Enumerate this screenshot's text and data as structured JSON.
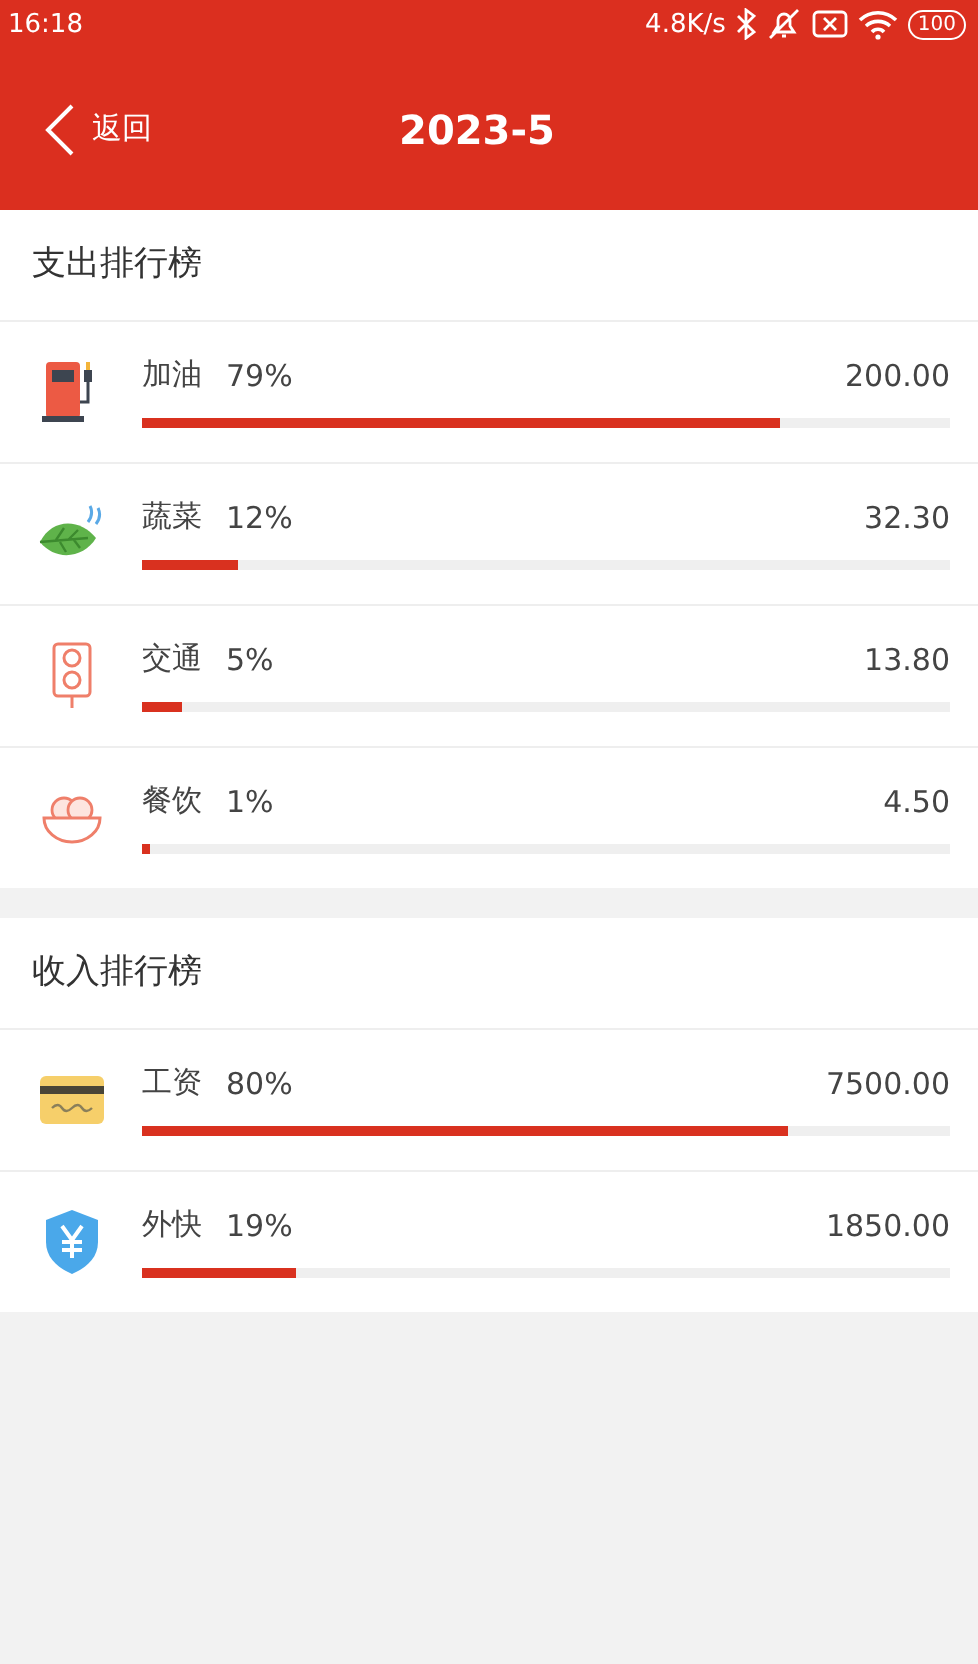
{
  "status_bar": {
    "time": "16:18",
    "speed": "4.8K/s",
    "battery": "100"
  },
  "header": {
    "back": "返回",
    "title": "2023-5"
  },
  "sections": [
    {
      "title": "支出排行榜",
      "items": [
        {
          "kind": "fuel",
          "name": "加油",
          "percent": "79%",
          "amount": "200.00",
          "level": 0.79
        },
        {
          "kind": "leaf",
          "name": "蔬菜",
          "percent": "12%",
          "amount": "32.30",
          "level": 0.12
        },
        {
          "kind": "traffic",
          "name": "交通",
          "percent": "5%",
          "amount": "13.80",
          "level": 0.05
        },
        {
          "kind": "bowl",
          "name": "餐饮",
          "percent": "1%",
          "amount": "4.50",
          "level": 0.01
        }
      ]
    },
    {
      "title": "收入排行榜",
      "items": [
        {
          "kind": "card",
          "name": "工资",
          "percent": "80%",
          "amount": "7500.00",
          "level": 0.8
        },
        {
          "kind": "shield",
          "name": "外快",
          "percent": "19%",
          "amount": "1850.00",
          "level": 0.19
        }
      ]
    }
  ]
}
